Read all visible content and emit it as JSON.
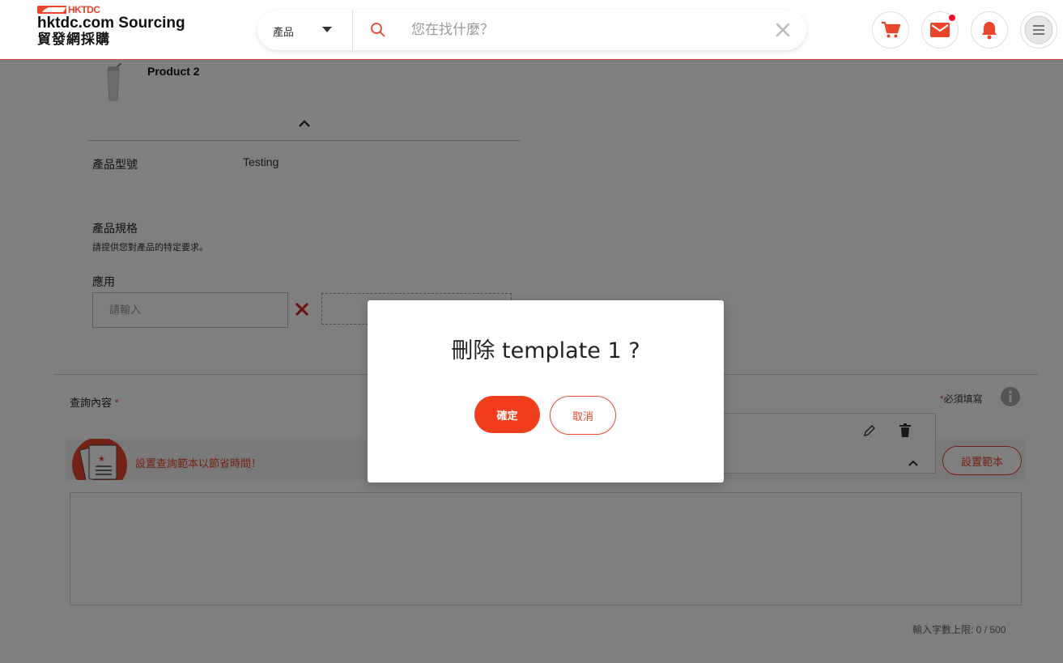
{
  "header": {
    "logo_brand": "HKTDC",
    "logo_line1": "hktdc.com Sourcing",
    "logo_line2": "貿發網採購",
    "search": {
      "category": "產品",
      "placeholder": "您在找什麼？"
    },
    "icons": [
      "cart-icon",
      "mail-icon",
      "bell-icon",
      "menu-icon"
    ],
    "mail_has_notification": true
  },
  "product": {
    "name": "Product 2",
    "model_label": "產品型號",
    "model_value": "Testing",
    "spec_label": "產品規格",
    "spec_hint": "請提供您對產品的特定要求。",
    "application_label": "應用",
    "application_placeholder": "請輸入"
  },
  "enquiry": {
    "label": "查詢內容",
    "required_star": "*",
    "required_note": "必須填寫",
    "template_banner_text": "設置查詢範本以節省時間！",
    "set_template_button": "設置範本",
    "char_count": "輸入字數上限: 0 / 500"
  },
  "modal": {
    "title": "刪除 template 1 ?",
    "confirm_label": "確定",
    "cancel_label": "取消"
  },
  "colors": {
    "accent": "#e8452c",
    "confirm_button": "#f03e1c",
    "notification_dot": "#e8112d"
  }
}
